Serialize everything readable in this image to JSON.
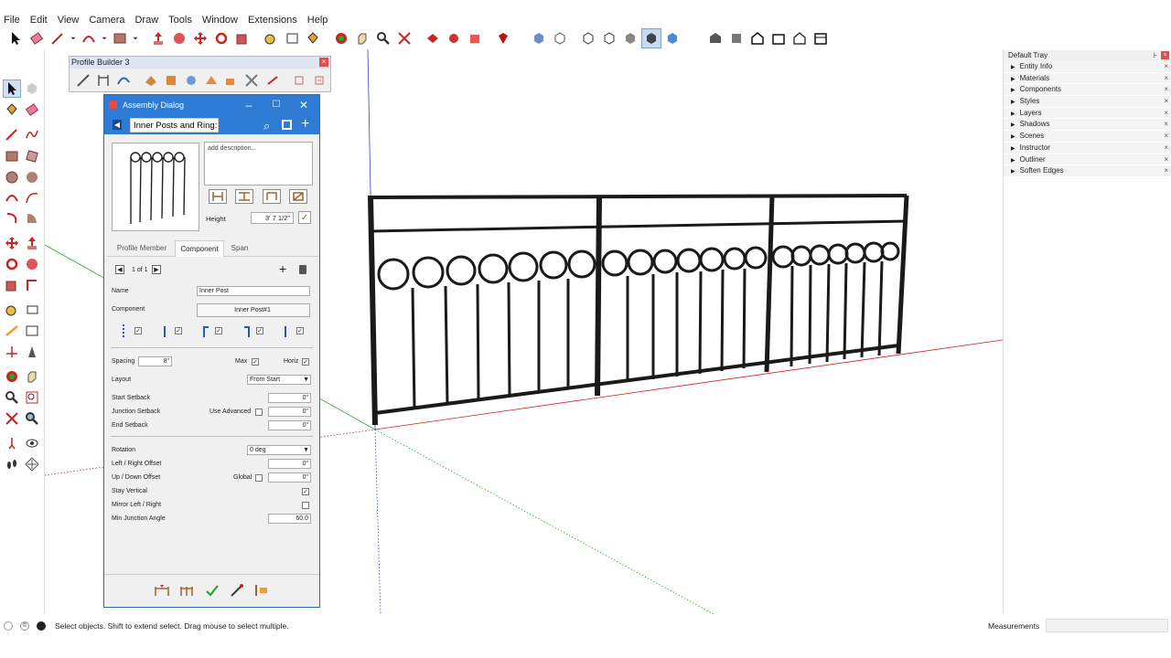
{
  "menu": [
    "File",
    "Edit",
    "View",
    "Camera",
    "Draw",
    "Tools",
    "Window",
    "Extensions",
    "Help"
  ],
  "profile_builder": {
    "title": "Profile Builder 3",
    "close": "×"
  },
  "dialog": {
    "title": "Assembly Dialog",
    "search_value": "Inner Posts and Ring:",
    "description": "add description...",
    "height_label": "Height",
    "height_value": "3' 7 1/2\"",
    "tabs": [
      "Profile Member",
      "Component",
      "Span"
    ],
    "pager": "1 of 1",
    "name_label": "Name",
    "name_value": "Inner Post",
    "component_label": "Component",
    "component_value": "Inner Post#1",
    "spacing_label": "Spacing",
    "spacing_value": "8\"",
    "max_label": "Max",
    "horiz_label": "Horiz",
    "layout_label": "Layout",
    "layout_value": "From Start",
    "start_setback_label": "Start Setback",
    "start_setback_value": "0\"",
    "junction_setback_label": "Junction Setback",
    "use_advanced_label": "Use Advanced",
    "junction_setback_value": "0\"",
    "end_setback_label": "End Setback",
    "end_setback_value": "0\"",
    "rotation_label": "Rotation",
    "rotation_value": "0 deg",
    "lr_offset_label": "Left / Right Offset",
    "lr_offset_value": "0\"",
    "ud_offset_label": "Up / Down Offset",
    "global_label": "Global",
    "ud_offset_value": "0\"",
    "stay_vertical_label": "Stay Vertical",
    "mirror_label": "Mirror Left / Right",
    "min_junction_label": "Min Junction Angle",
    "min_junction_value": "60.0"
  },
  "tray": {
    "title": "Default Tray",
    "items": [
      "Entity Info",
      "Materials",
      "Components",
      "Styles",
      "Layers",
      "Shadows",
      "Scenes",
      "Instructor",
      "Outliner",
      "Soften Edges"
    ]
  },
  "status": {
    "text": "Select objects. Shift to extend select. Drag mouse to select multiple.",
    "measurements_label": "Measurements"
  },
  "colors": {
    "accent": "#2e7bd6",
    "red_axis": "#cc2222",
    "green_axis": "#22aa22",
    "blue_axis": "#3344cc"
  }
}
